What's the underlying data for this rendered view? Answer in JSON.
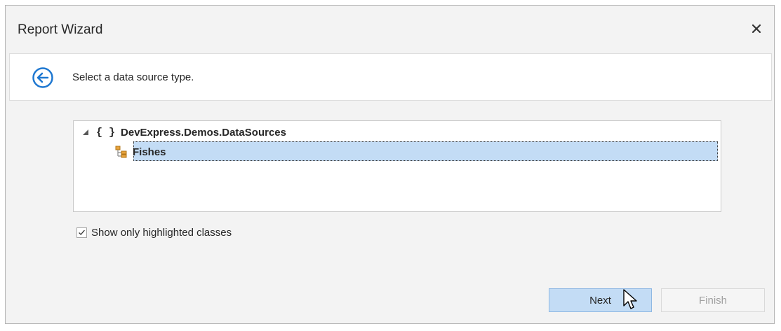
{
  "window": {
    "title": "Report Wizard"
  },
  "header": {
    "instruction": "Select a data source type."
  },
  "tree": {
    "root": {
      "braces": "{ }",
      "label": "DevExpress.Demos.DataSources"
    },
    "children": [
      {
        "label": "Fishes",
        "selected": true
      }
    ]
  },
  "options": {
    "show_highlighted_label": "Show only highlighted classes",
    "show_highlighted_checked": true
  },
  "buttons": {
    "next": "Next",
    "finish": "Finish"
  },
  "colors": {
    "accent": "#1f78d1",
    "selection": "#c3dcf5",
    "icon_orange": "#e8a33d"
  }
}
